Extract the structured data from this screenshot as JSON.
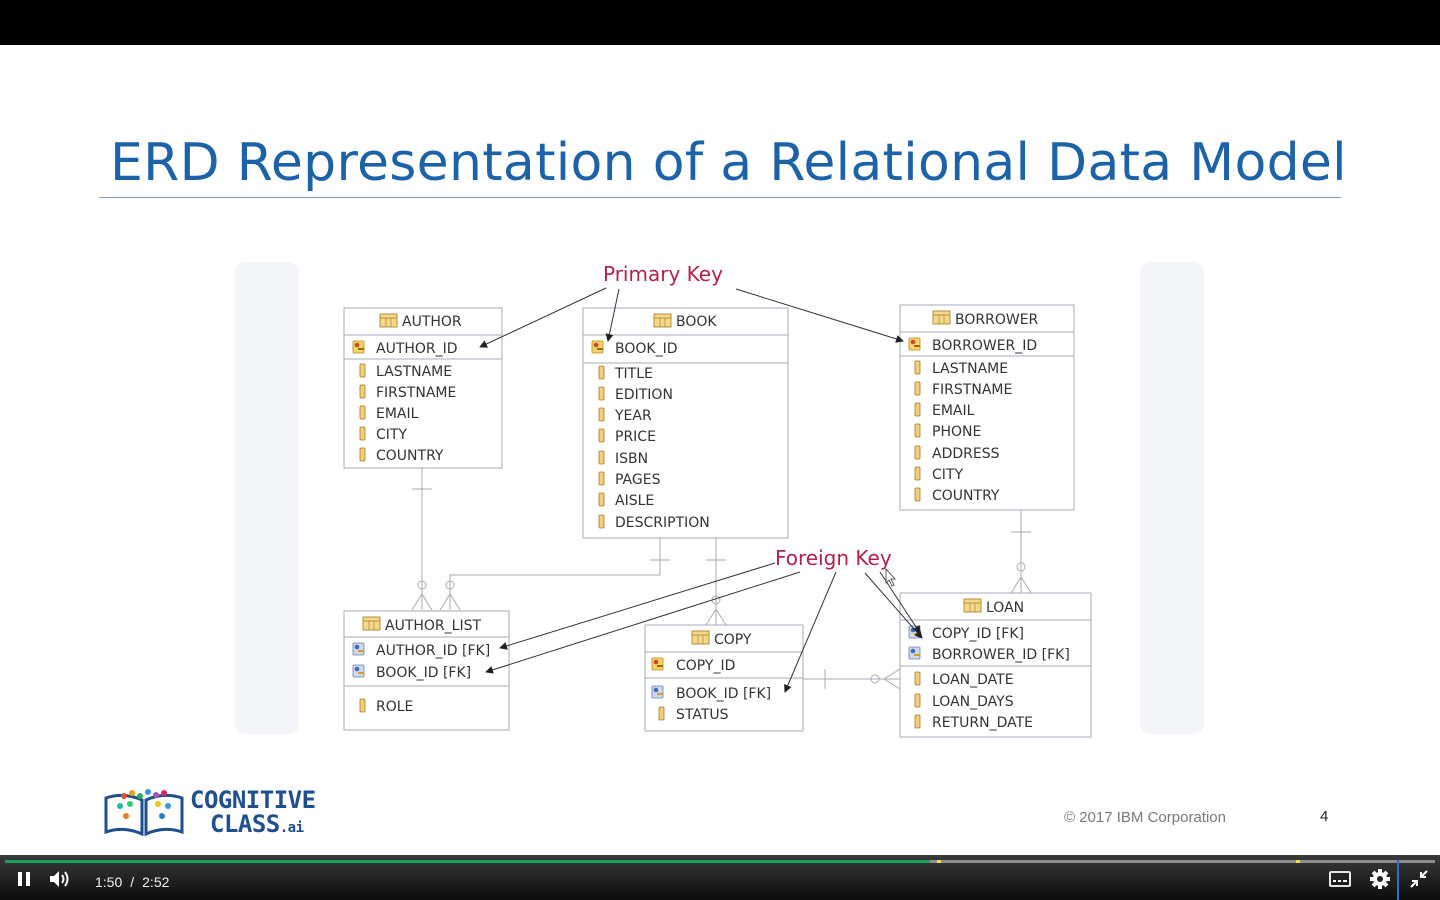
{
  "slide": {
    "title": "ERD Representation of a Relational Data Model",
    "copyright": "© 2017 IBM Corporation",
    "page_number": "4",
    "logo": {
      "line1": "COGNITIVE",
      "line2": "CLASS",
      "suffix": ".ai"
    }
  },
  "diagram": {
    "callouts": {
      "primary_key": "Primary Key",
      "foreign_key": "Foreign Key"
    },
    "entities": {
      "author": {
        "name": "AUTHOR",
        "key": "AUTHOR_ID",
        "fields": [
          "LASTNAME",
          "FIRSTNAME",
          "EMAIL",
          "CITY",
          "COUNTRY"
        ]
      },
      "book": {
        "name": "BOOK",
        "key": "BOOK_ID",
        "fields": [
          "TITLE",
          "EDITION",
          "YEAR",
          "PRICE",
          "ISBN",
          "PAGES",
          "AISLE",
          "DESCRIPTION"
        ]
      },
      "borrower": {
        "name": "BORROWER",
        "key": "BORROWER_ID",
        "fields": [
          "LASTNAME",
          "FIRSTNAME",
          "EMAIL",
          "PHONE",
          "ADDRESS",
          "CITY",
          "COUNTRY"
        ]
      },
      "author_list": {
        "name": "AUTHOR_LIST",
        "keys": [
          "AUTHOR_ID [FK]",
          "BOOK_ID [FK]"
        ],
        "fields": [
          "ROLE"
        ]
      },
      "copy": {
        "name": "COPY",
        "key": "COPY_ID",
        "fk_fields": [
          "BOOK_ID [FK]"
        ],
        "fields": [
          "STATUS"
        ]
      },
      "loan": {
        "name": "LOAN",
        "keys": [
          "COPY_ID [FK]",
          "BORROWER_ID [FK]"
        ],
        "fields": [
          "LOAN_DATE",
          "LOAN_DAYS",
          "RETURN_DATE"
        ]
      }
    }
  },
  "player": {
    "current_time": "1:50",
    "separator": "/",
    "duration": "2:52",
    "progress_fraction": 0.647,
    "chapter_markers": [
      0.652,
      0.903
    ],
    "colors": {
      "progress": "#1aa05c",
      "marker": "#e9e04a"
    },
    "icons": [
      "pause-icon",
      "volume-icon",
      "captions-icon",
      "settings-icon",
      "exit-fullscreen-icon"
    ]
  }
}
